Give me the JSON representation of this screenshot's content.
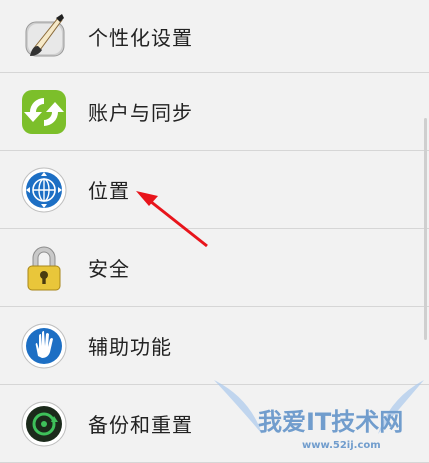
{
  "settings": {
    "items": [
      {
        "label": "个性化设置",
        "icon": "paintbrush-icon"
      },
      {
        "label": "账户与同步",
        "icon": "sync-icon"
      },
      {
        "label": "位置",
        "icon": "globe-icon"
      },
      {
        "label": "安全",
        "icon": "lock-icon"
      },
      {
        "label": "辅助功能",
        "icon": "hand-icon"
      },
      {
        "label": "备份和重置",
        "icon": "backup-icon"
      }
    ]
  },
  "watermark": {
    "text": "我爱IT技术网",
    "url": "www.52ij.com"
  },
  "colors": {
    "background": "#f2f2f2",
    "divider": "#d6d6d6",
    "annotation_arrow": "#e8141b"
  }
}
